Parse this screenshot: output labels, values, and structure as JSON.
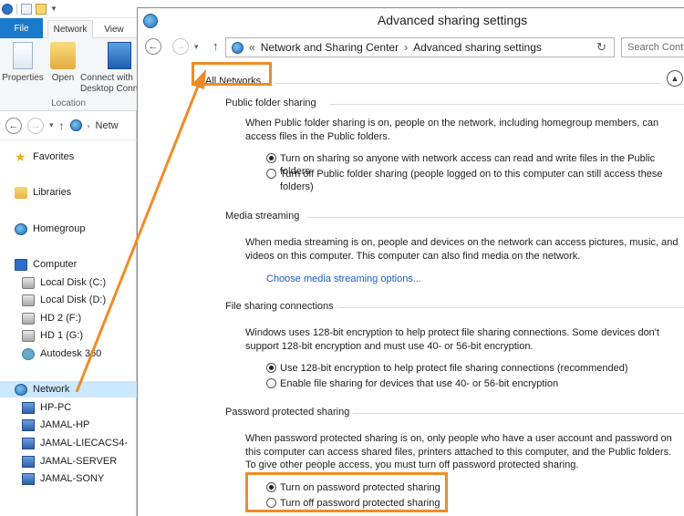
{
  "explorer": {
    "tabs": {
      "file": "File",
      "network": "Network",
      "view": "View"
    },
    "ribbon": {
      "properties": "Properties",
      "open": "Open",
      "connect_line1": "Connect with",
      "connect_line2": "Desktop Conn",
      "group_label": "Location"
    },
    "address": "Netw",
    "tree": {
      "favorites": "Favorites",
      "libraries": "Libraries",
      "homegroup": "Homegroup",
      "computer": "Computer",
      "local_c": "Local Disk (C:)",
      "local_d": "Local Disk (D:)",
      "hd2": "HD 2 (F:)",
      "hd1": "HD 1 (G:)",
      "autodesk": "Autodesk 360",
      "network": "Network",
      "hp_pc": "HP-PC",
      "jamal_hp": "JAMAL-HP",
      "jamal_liecacs": "JAMAL-LIECACS4-",
      "jamal_server": "JAMAL-SERVER",
      "jamal_sony": "JAMAL-SONY"
    }
  },
  "dialog": {
    "title": "Advanced sharing settings",
    "breadcrumb": {
      "root": "Network and Sharing Center",
      "current": "Advanced sharing settings"
    },
    "search_placeholder": "Search Contr",
    "section_label": "All Networks",
    "public_folder": {
      "heading": "Public folder sharing",
      "description": "When Public folder sharing is on, people on the network, including homegroup members, can access files in the Public folders.",
      "option_on": "Turn on sharing so anyone with network access can read and write files in the Public folders",
      "option_off": "Turn off Public folder sharing (people logged on to this computer can still access these folders)"
    },
    "media": {
      "heading": "Media streaming",
      "description": "When media streaming is on, people and devices on the network can access pictures, music, and videos on this computer. This computer can also find media on the network.",
      "link": "Choose media streaming options..."
    },
    "file_sharing": {
      "heading": "File sharing connections",
      "description": "Windows uses 128-bit encryption to help protect file sharing connections. Some devices don't support 128-bit encryption and must use 40- or 56-bit encryption.",
      "option_128": "Use 128-bit encryption to help protect file sharing connections (recommended)",
      "option_40": "Enable file sharing for devices that use 40- or 56-bit encryption"
    },
    "password": {
      "heading": "Password protected sharing",
      "description": "When password protected sharing is on, only people who have a user account and password on this computer can access shared files, printers attached to this computer, and the Public folders. To give other people access, you must turn off password protected sharing.",
      "option_on": "Turn on password protected sharing",
      "option_off": "Turn off password protected sharing"
    }
  },
  "colors": {
    "annotation": "#f08c24",
    "link": "#1b5fc1",
    "file_tab": "#1979ca",
    "selected": "#cce8ff"
  }
}
